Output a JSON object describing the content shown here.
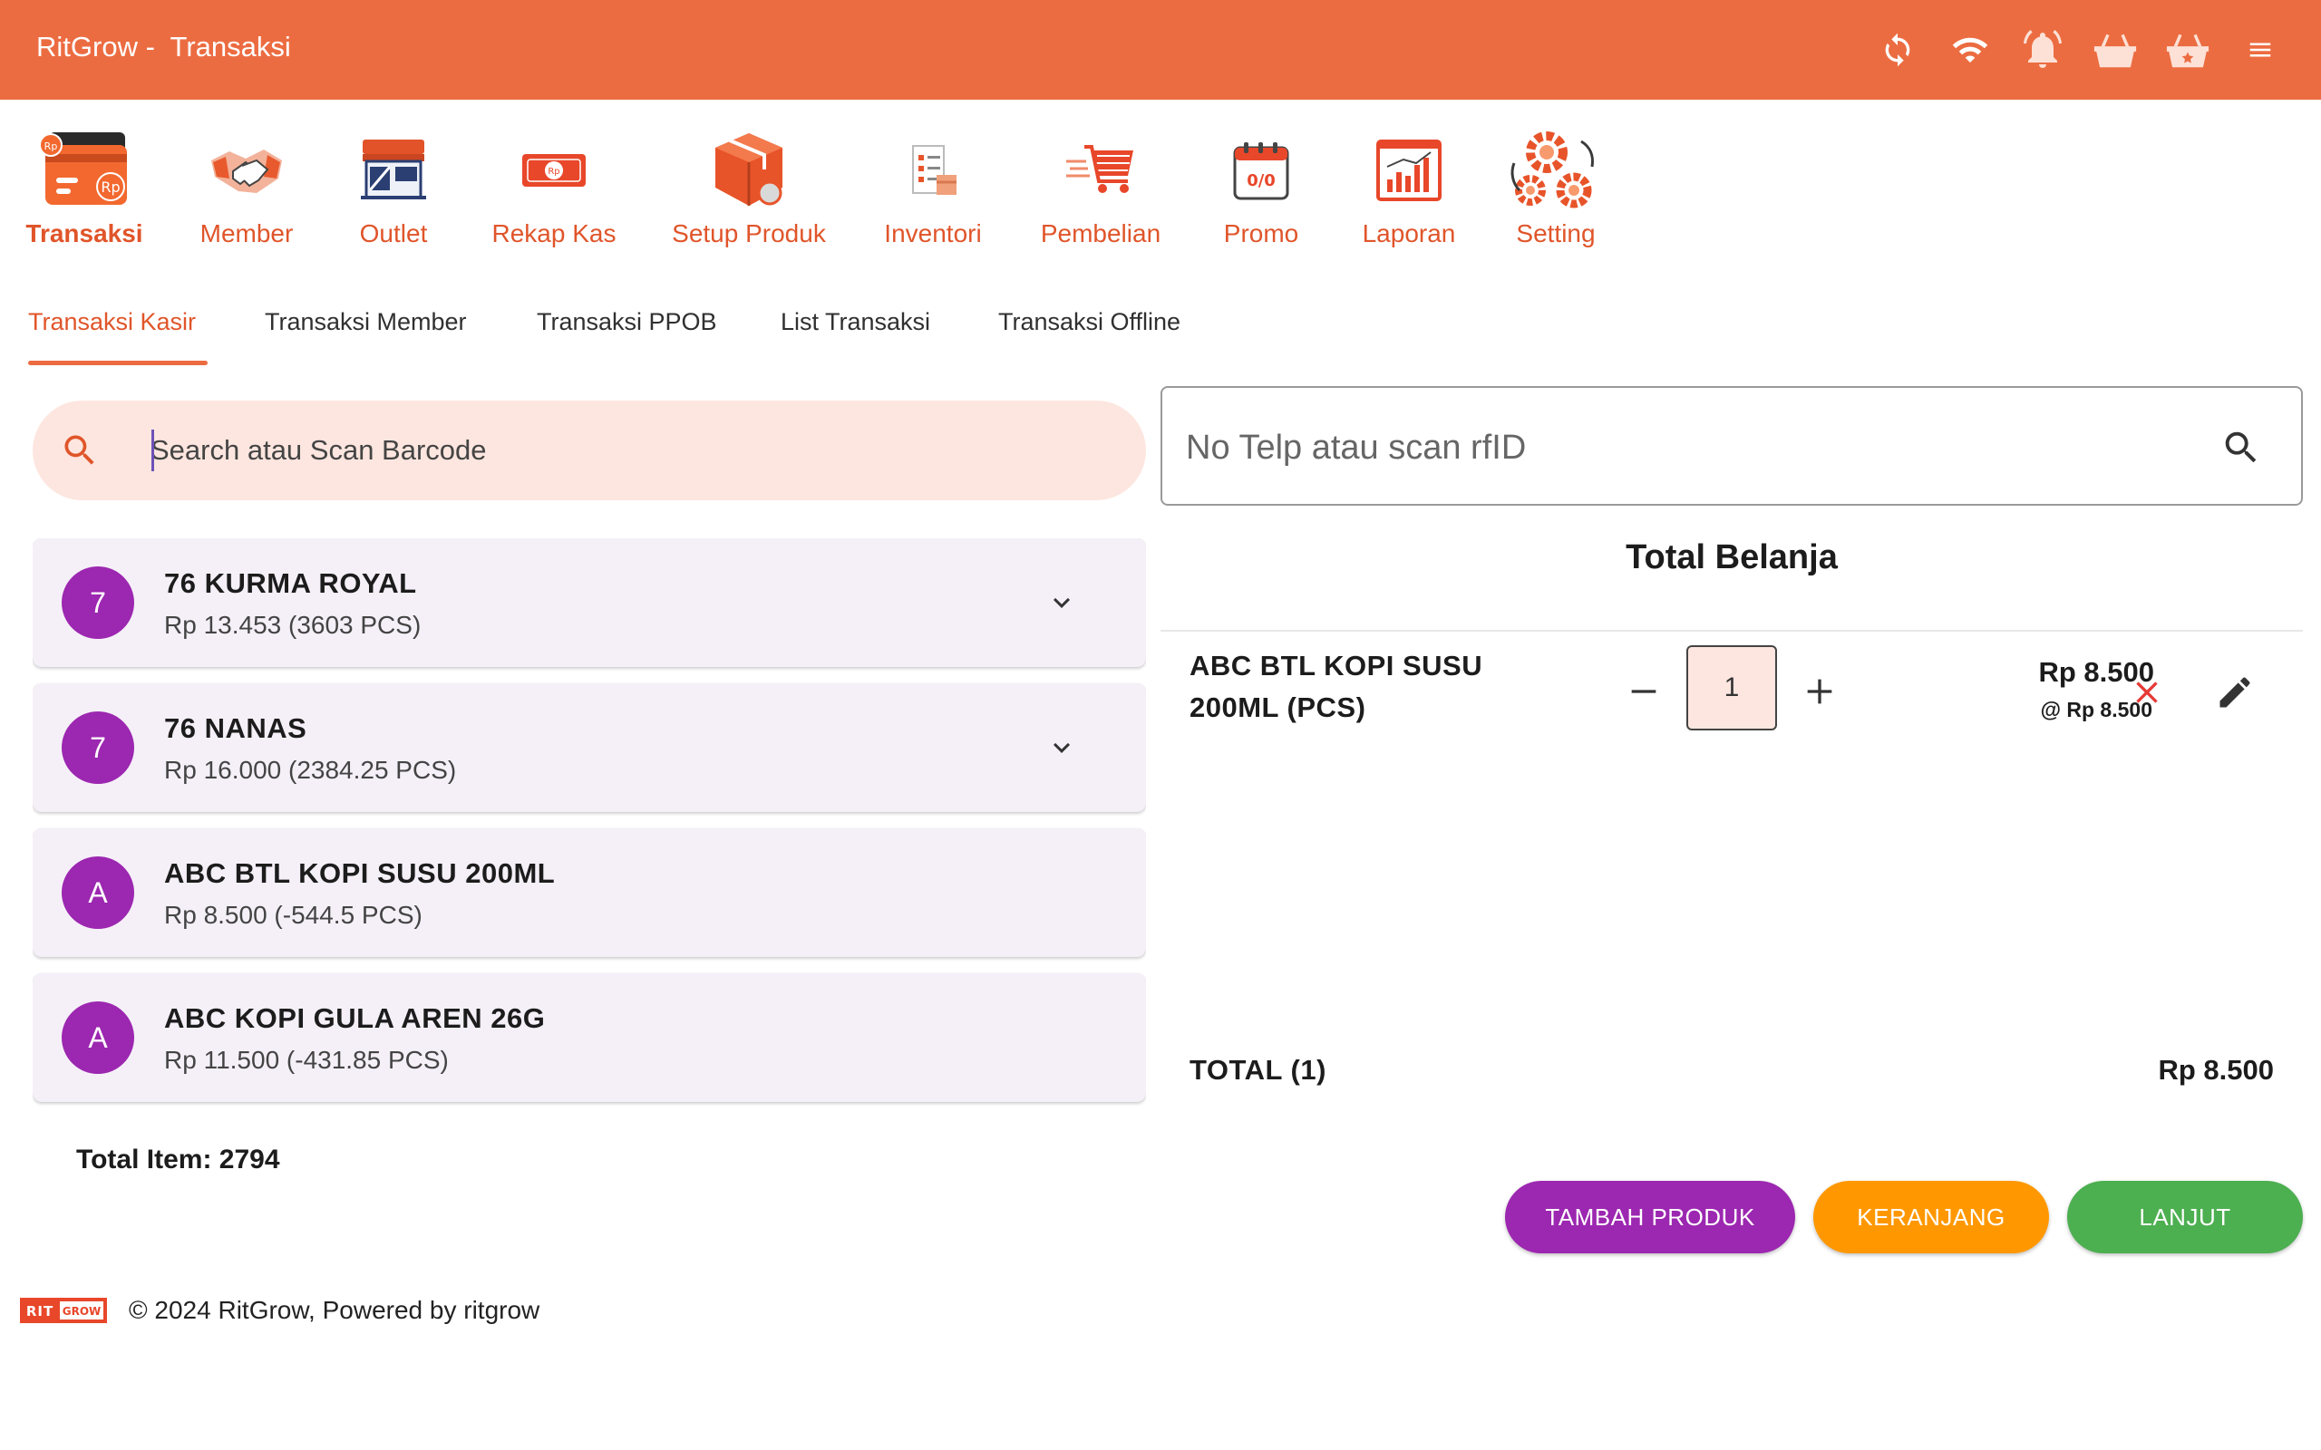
{
  "app": {
    "title": "RitGrow -  Transaksi",
    "accent": "#ec6c41",
    "actions": [
      {
        "icon": "sync-icon"
      },
      {
        "icon": "wifi-icon"
      },
      {
        "icon": "bell-icon"
      },
      {
        "icon": "basket-icon"
      },
      {
        "icon": "favorite-basket-icon"
      },
      {
        "icon": "menu-icon"
      }
    ]
  },
  "modules": [
    {
      "label": "Transaksi",
      "icon": "transaction-card-icon",
      "active": true
    },
    {
      "label": "Member",
      "icon": "handshake-icon"
    },
    {
      "label": "Outlet",
      "icon": "store-icon"
    },
    {
      "label": "Rekap Kas",
      "icon": "cash-icon"
    },
    {
      "label": "Setup Produk",
      "icon": "product-box-icon"
    },
    {
      "label": "Inventori",
      "icon": "inventory-icon"
    },
    {
      "label": "Pembelian",
      "icon": "shopping-cart-icon"
    },
    {
      "label": "Promo",
      "icon": "promo-calendar-icon"
    },
    {
      "label": "Laporan",
      "icon": "report-chart-icon"
    },
    {
      "label": "Setting",
      "icon": "gears-icon"
    }
  ],
  "tabs": [
    {
      "label": "Transaksi Kasir",
      "active": true
    },
    {
      "label": "Transaksi Member"
    },
    {
      "label": "Transaksi PPOB"
    },
    {
      "label": "List Transaksi"
    },
    {
      "label": "Transaksi Offline"
    }
  ],
  "search": {
    "placeholder": "Search atau Scan Barcode",
    "icon": "search-icon"
  },
  "products": [
    {
      "avatar": "7",
      "name": "76 KURMA ROYAL",
      "price": "Rp 13.453 (3603 PCS)",
      "expandable": true
    },
    {
      "avatar": "7",
      "name": "76 NANAS",
      "price": "Rp 16.000 (2384.25 PCS)",
      "expandable": true
    },
    {
      "avatar": "A",
      "name": "ABC BTL KOPI SUSU 200ML",
      "price": "Rp 8.500 (-544.5 PCS)",
      "expandable": false
    },
    {
      "avatar": "A",
      "name": "ABC KOPI GULA AREN 26G",
      "price": "Rp 11.500 (-431.85 PCS)",
      "expandable": false
    }
  ],
  "total_items": "Total Item: 2794",
  "member_search": {
    "placeholder": "No Telp atau scan rfID"
  },
  "cart": {
    "title": "Total Belanja",
    "items": [
      {
        "name": "ABC BTL KOPI SUSU 200ML (PCS)",
        "qty": "1",
        "subtotal": "Rp 8.500",
        "unit_price": "@ Rp 8.500"
      }
    ],
    "total_label": "TOTAL (1)",
    "total_value": "Rp 8.500"
  },
  "buttons": {
    "add_product": "TAMBAH PRODUK",
    "cart": "KERANJANG",
    "next": "LANJUT",
    "colors": {
      "add_product": "#9c27b0",
      "cart": "#ff9800",
      "next": "#4caf50"
    }
  },
  "footer": {
    "logo": "RITGROW",
    "text": "© 2024 RitGrow, Powered by ritgrow"
  }
}
